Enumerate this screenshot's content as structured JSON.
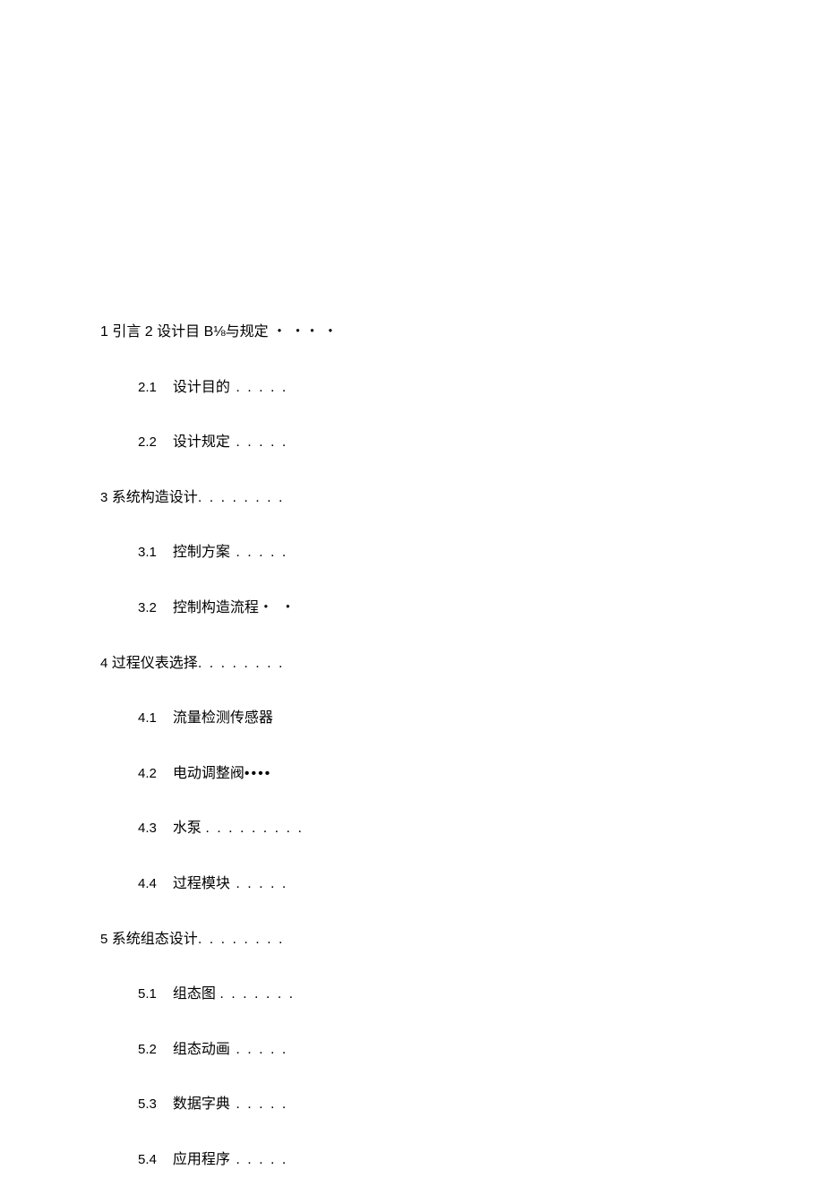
{
  "toc": {
    "line1": "1 引言 2 设计目 B⅛与规定 ・ ・・ ・",
    "entries": [
      {
        "level": 2,
        "num": "2.1",
        "title": "设计目的",
        "leader": " . . . . ."
      },
      {
        "level": 2,
        "num": "2.2",
        "title": "设计规定",
        "leader": " . . . . ."
      },
      {
        "level": 1,
        "num": "3",
        "title": "系统构造设计",
        "leader": ". . . . . . . ."
      },
      {
        "level": 2,
        "num": "3.1",
        "title": "控制方案",
        "leader": " . . . . ."
      },
      {
        "level": 2,
        "num": "3.2",
        "title": "控制构造流程",
        "leader": "・ ・"
      },
      {
        "level": 1,
        "num": "4",
        "title": "过程仪表选择",
        "leader": ". . . . . . . ."
      },
      {
        "level": 2,
        "num": "4.1",
        "title": "流量检测传感器",
        "leader": ""
      },
      {
        "level": 2,
        "num": "4.2",
        "title": "电动调整阀",
        "leader": "••••"
      },
      {
        "level": 2,
        "num": "4.3",
        "title": "水泵 ",
        "leader": ". . . . . . . . ."
      },
      {
        "level": 2,
        "num": "4.4",
        "title": "过程模块",
        "leader": " . . . . ."
      },
      {
        "level": 1,
        "num": "5",
        "title": "系统组态设计",
        "leader": ". . . . . . . ."
      },
      {
        "level": 2,
        "num": "5.1",
        "title": "组态图 ",
        "leader": ". . . . . . ."
      },
      {
        "level": 2,
        "num": "5.2",
        "title": "组态动画",
        "leader": " . . . . ."
      },
      {
        "level": 2,
        "num": "5.3",
        "title": "数据字典",
        "leader": " . . . . ."
      },
      {
        "level": 2,
        "num": "5.4",
        "title": "应用程序",
        "leader": " . . . . ."
      }
    ]
  }
}
